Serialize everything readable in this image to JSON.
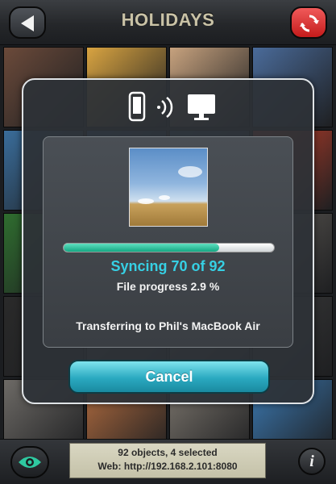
{
  "header": {
    "title": "HOLIDAYS",
    "back_icon": "back-arrow-icon",
    "refresh_icon": "refresh-icon",
    "refresh_color": "#d42424"
  },
  "grid": {
    "tiles": [
      {
        "color": "#6b4a3a"
      },
      {
        "color": "#d9a441"
      },
      {
        "color": "#c7a27e"
      },
      {
        "color": "#4a6b9a"
      },
      {
        "color": "#3a6d9b"
      },
      {
        "color": "#2f5f8c"
      },
      {
        "color": "#355a7d"
      },
      {
        "color": "#c7402a"
      },
      {
        "color": "#2f6d2f"
      },
      {
        "color": "#385d88"
      },
      {
        "color": "#466a8d"
      },
      {
        "color": "#5e5a55"
      },
      {
        "color": "#2a2a2a"
      },
      {
        "color": "#4a4a48"
      },
      {
        "color": "#5d5a56"
      },
      {
        "color": "#3a3a3a"
      },
      {
        "color": "#6d6a66"
      },
      {
        "color": "#b06b3f"
      },
      {
        "color": "#7a746c"
      },
      {
        "color": "#3b78b0"
      }
    ]
  },
  "modal": {
    "device_icons": [
      "phone-icon",
      "wifi-signal-icon",
      "monitor-icon"
    ],
    "progress_fraction": 0.74,
    "sync_text": "Syncing 70 of 92",
    "file_progress": "File progress 2.9 %",
    "transfer_text": "Transferring to Phil's MacBook Air",
    "cancel_label": "Cancel",
    "accent_color": "#36d0e4"
  },
  "footer": {
    "status_line1": "92 objects, 4 selected",
    "status_line2": "Web: http://192.168.2.101:8080",
    "eye_icon": "eye-icon",
    "info_icon": "info-icon",
    "info_glyph": "i",
    "eye_color": "#2fc9a0"
  }
}
